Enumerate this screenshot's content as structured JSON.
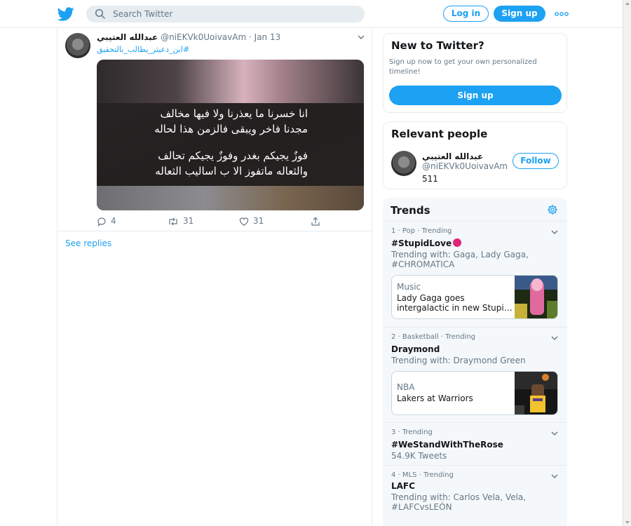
{
  "header": {
    "search_placeholder": "Search Twitter",
    "login_label": "Log in",
    "signup_label": "Sign up"
  },
  "tweet": {
    "author_name": "عبدالله العتيبي",
    "author_handle": "@niEKVk0UoivavAm",
    "separator": "·",
    "date": "Jan 13",
    "hashtag": "#ابن_دعيثر_يطالب_بالتحقيق",
    "image_text": [
      "انا خسرنا ما يعذرنا ولا فيها مخالف",
      "مجدنا فاخر ويبقى فالزمن هذا لحاله",
      "فوزٌ يجيكم بغدر وفوزٌ يجيكم تحالف",
      "والثعاله ماتفوز الا ب اساليب الثعاله"
    ],
    "replies": "4",
    "retweets": "31",
    "likes": "31"
  },
  "see_replies": "See replies",
  "new_to_twitter": {
    "title": "New to Twitter?",
    "description": "Sign up now to get your own personalized timeline!",
    "signup_label": "Sign up"
  },
  "relevant_people": {
    "title": "Relevant people",
    "name": "عبدالله العتيبي",
    "handle": "@niEKVk0UoivavAm",
    "count": "511",
    "follow_label": "Follow"
  },
  "trends": {
    "title": "Trends",
    "items": [
      {
        "meta": "1 · Pop · Trending",
        "name": "#StupidLove",
        "sub": "Trending with: Gaga, Lady Gaga, #CHROMATICA",
        "news_category": "Music",
        "news_title": "Lady Gaga goes intergalactic in new Stupi…"
      },
      {
        "meta": "2 · Basketball · Trending",
        "name": "Draymond",
        "sub": "Trending with: Draymond Green",
        "news_category": "NBA",
        "news_title": "Lakers at Warriors"
      },
      {
        "meta": "3 · Trending",
        "name": "#WeStandWithTheRose",
        "sub": "54.9K Tweets"
      },
      {
        "meta": "4 · MLS · Trending",
        "name": "LAFC",
        "sub": "Trending with: Carlos Vela, Vela, #LAFCvsLEÓN"
      }
    ]
  },
  "colors": {
    "accent": "#1da1f2",
    "text": "#14171a",
    "muted": "#657786",
    "border": "#e6ecf0",
    "panel": "#f5f8fa"
  }
}
